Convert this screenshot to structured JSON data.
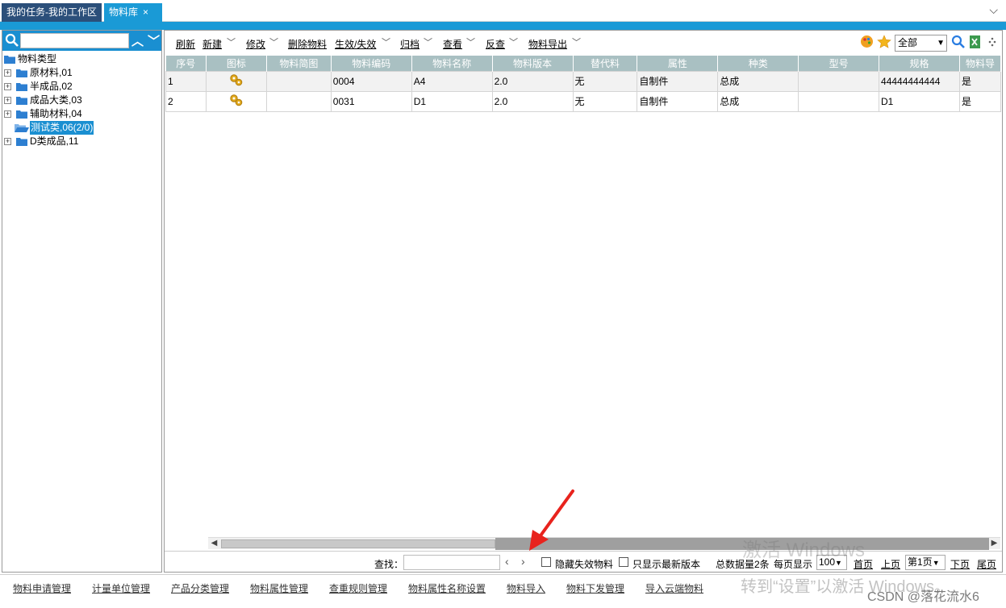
{
  "tabs": [
    {
      "label": "我的任务-我的工作区",
      "active": false
    },
    {
      "label": "物料库",
      "active": true,
      "close": "×"
    }
  ],
  "tree": {
    "root": "物料类型",
    "items": [
      {
        "label": "原材料,01"
      },
      {
        "label": "半成品,02"
      },
      {
        "label": "成品大类,03"
      },
      {
        "label": "辅助材料,04"
      },
      {
        "label": "测试类,06(2/0)",
        "selected": true
      },
      {
        "label": "D类成品,11"
      }
    ]
  },
  "toolbar": {
    "refresh": "刷新",
    "new": "新建",
    "edit": "修改",
    "delete": "删除物料",
    "enable": "生效/失效",
    "archive": "归档",
    "view": "查看",
    "reverse": "反查",
    "export": "物料导出",
    "filter_value": "全部"
  },
  "table": {
    "headers": [
      "序号",
      "图标",
      "物料简图",
      "物料编码",
      "物料名称",
      "物料版本",
      "替代料",
      "属性",
      "种类",
      "型号",
      "规格",
      "物料导"
    ],
    "rows": [
      {
        "no": "1",
        "code": "0004",
        "name": "A4",
        "version": "2.0",
        "substitute": "无",
        "attr": "自制件",
        "kind": "总成",
        "model": "",
        "spec": "44444444444",
        "flag": "是"
      },
      {
        "no": "2",
        "code": "0031",
        "name": "D1",
        "version": "2.0",
        "substitute": "无",
        "attr": "自制件",
        "kind": "总成",
        "model": "",
        "spec": "D1",
        "flag": "是"
      }
    ]
  },
  "pager": {
    "find_label": "查找：",
    "hide_invalid": "隐藏失效物料",
    "latest_only": "只显示最新版本",
    "total": "总数据量2条",
    "per_page_label": "每页显示",
    "per_page": "100",
    "first": "首页",
    "prev": "上页",
    "page": "第1页",
    "next": "下页",
    "last": "尾页"
  },
  "funcbar": [
    "物料申请管理",
    "计量单位管理",
    "产品分类管理",
    "物料属性管理",
    "查重规则管理",
    "物料属性名称设置",
    "物料导入",
    "物料下发管理",
    "导入云端物料"
  ],
  "watermark": {
    "line1": "激活 Windows",
    "line2": "转到“设置”以激活 Windows。",
    "csdn": "CSDN @落花流水6"
  },
  "colors": {
    "accent": "#1a9ad6",
    "tab_dark": "#2b4f7a",
    "header_bg": "#a9c0c2",
    "arrow": "#e8231d"
  }
}
